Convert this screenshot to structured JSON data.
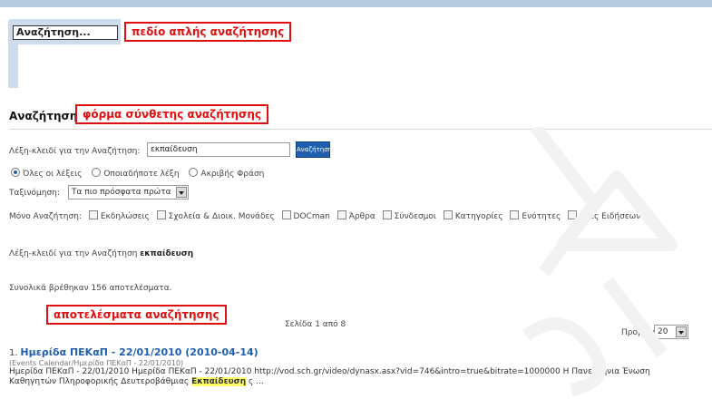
{
  "simple_search": {
    "value": "Αναζήτηση...",
    "annotation": "πεδίο απλής αναζήτησης"
  },
  "advanced": {
    "title": "Αναζήτηση",
    "annotation": "φόρμα σύνθετης αναζήτησης",
    "keyword_label": "Λέξη-κλειδί για την Αναζήτηση:",
    "keyword_value": "εκπαίδευση",
    "search_button": "Αναζήτηση",
    "match_options": [
      "Όλες οι λέξεις",
      "Οποιαδήποτε λέξη",
      "Ακριβής Φράση"
    ],
    "match_selected": 0,
    "sort_label": "Ταξινόμηση:",
    "sort_value": "Τα πιο πρόσφατα πρώτα",
    "only_label": "Μόνο Αναζήτηση:",
    "areas": [
      "Εκδηλώσεις",
      "Σχολεία & Διοικ. Μονάδες",
      "DOCman",
      "Άρθρα",
      "Σύνδεσμοι",
      "Κατηγορίες",
      "Ενότητες",
      "Ροές Ειδήσεων"
    ]
  },
  "results": {
    "keyword_label": "Λέξη-κλειδί για την Αναζήτηση",
    "keyword": "εκπαίδευση",
    "total_text": "Συνολικά βρέθηκαν 156 αποτελέσματα.",
    "annotation": "αποτελέσματα αναζήτησης",
    "page_info": "Σελίδα 1 από 8",
    "view_label": "Προβολή #",
    "view_value": "20",
    "items": [
      {
        "number": "1.",
        "title": "Ημερίδα ΠΕΚαΠ - 22/01/2010 (2010-04-14)",
        "path": "(Events Calendar/Ημερίδα ΠΕΚαΠ - 22/01/2010)",
        "line1": "Ημερίδα ΠΕΚαΠ - 22/01/2010    Ημερίδα ΠΕΚαΠ - 22/01/2010    http://vod.sch.gr/video/dynasx.asx?vid=746&intro=true&bitrate=1000000 Η Πανελλήνια Ένωση",
        "line2_before": "Καθηγητών Πληροφορικής Δευτεροβάθμιας ",
        "line2_highlight": "Εκπαίδευση",
        "line2_after": " ς ..."
      }
    ]
  },
  "watermark_text": "ΔΕΙΓΜΑ"
}
